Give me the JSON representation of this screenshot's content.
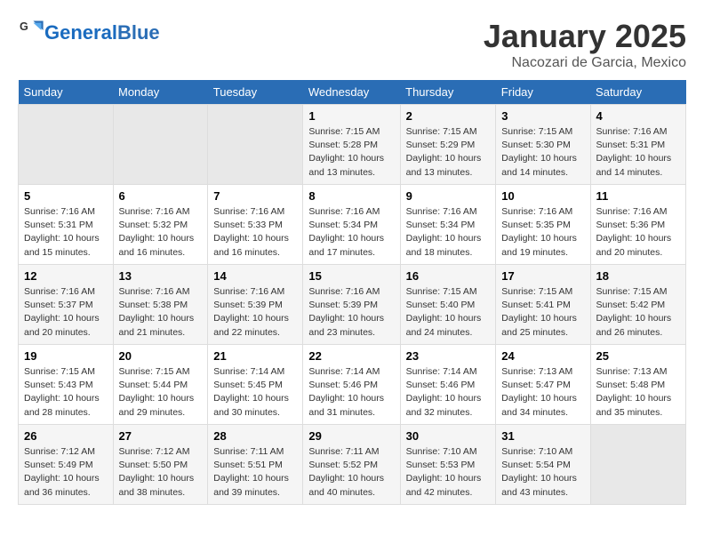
{
  "header": {
    "logo_general": "General",
    "logo_blue": "Blue",
    "month": "January 2025",
    "location": "Nacozari de Garcia, Mexico"
  },
  "days_of_week": [
    "Sunday",
    "Monday",
    "Tuesday",
    "Wednesday",
    "Thursday",
    "Friday",
    "Saturday"
  ],
  "weeks": [
    [
      {
        "empty": true
      },
      {
        "empty": true
      },
      {
        "empty": true
      },
      {
        "day": 1,
        "sunrise": "7:15 AM",
        "sunset": "5:28 PM",
        "daylight": "10 hours and 13 minutes."
      },
      {
        "day": 2,
        "sunrise": "7:15 AM",
        "sunset": "5:29 PM",
        "daylight": "10 hours and 13 minutes."
      },
      {
        "day": 3,
        "sunrise": "7:15 AM",
        "sunset": "5:30 PM",
        "daylight": "10 hours and 14 minutes."
      },
      {
        "day": 4,
        "sunrise": "7:16 AM",
        "sunset": "5:31 PM",
        "daylight": "10 hours and 14 minutes."
      }
    ],
    [
      {
        "day": 5,
        "sunrise": "7:16 AM",
        "sunset": "5:31 PM",
        "daylight": "10 hours and 15 minutes."
      },
      {
        "day": 6,
        "sunrise": "7:16 AM",
        "sunset": "5:32 PM",
        "daylight": "10 hours and 16 minutes."
      },
      {
        "day": 7,
        "sunrise": "7:16 AM",
        "sunset": "5:33 PM",
        "daylight": "10 hours and 16 minutes."
      },
      {
        "day": 8,
        "sunrise": "7:16 AM",
        "sunset": "5:34 PM",
        "daylight": "10 hours and 17 minutes."
      },
      {
        "day": 9,
        "sunrise": "7:16 AM",
        "sunset": "5:34 PM",
        "daylight": "10 hours and 18 minutes."
      },
      {
        "day": 10,
        "sunrise": "7:16 AM",
        "sunset": "5:35 PM",
        "daylight": "10 hours and 19 minutes."
      },
      {
        "day": 11,
        "sunrise": "7:16 AM",
        "sunset": "5:36 PM",
        "daylight": "10 hours and 20 minutes."
      }
    ],
    [
      {
        "day": 12,
        "sunrise": "7:16 AM",
        "sunset": "5:37 PM",
        "daylight": "10 hours and 20 minutes."
      },
      {
        "day": 13,
        "sunrise": "7:16 AM",
        "sunset": "5:38 PM",
        "daylight": "10 hours and 21 minutes."
      },
      {
        "day": 14,
        "sunrise": "7:16 AM",
        "sunset": "5:39 PM",
        "daylight": "10 hours and 22 minutes."
      },
      {
        "day": 15,
        "sunrise": "7:16 AM",
        "sunset": "5:39 PM",
        "daylight": "10 hours and 23 minutes."
      },
      {
        "day": 16,
        "sunrise": "7:15 AM",
        "sunset": "5:40 PM",
        "daylight": "10 hours and 24 minutes."
      },
      {
        "day": 17,
        "sunrise": "7:15 AM",
        "sunset": "5:41 PM",
        "daylight": "10 hours and 25 minutes."
      },
      {
        "day": 18,
        "sunrise": "7:15 AM",
        "sunset": "5:42 PM",
        "daylight": "10 hours and 26 minutes."
      }
    ],
    [
      {
        "day": 19,
        "sunrise": "7:15 AM",
        "sunset": "5:43 PM",
        "daylight": "10 hours and 28 minutes."
      },
      {
        "day": 20,
        "sunrise": "7:15 AM",
        "sunset": "5:44 PM",
        "daylight": "10 hours and 29 minutes."
      },
      {
        "day": 21,
        "sunrise": "7:14 AM",
        "sunset": "5:45 PM",
        "daylight": "10 hours and 30 minutes."
      },
      {
        "day": 22,
        "sunrise": "7:14 AM",
        "sunset": "5:46 PM",
        "daylight": "10 hours and 31 minutes."
      },
      {
        "day": 23,
        "sunrise": "7:14 AM",
        "sunset": "5:46 PM",
        "daylight": "10 hours and 32 minutes."
      },
      {
        "day": 24,
        "sunrise": "7:13 AM",
        "sunset": "5:47 PM",
        "daylight": "10 hours and 34 minutes."
      },
      {
        "day": 25,
        "sunrise": "7:13 AM",
        "sunset": "5:48 PM",
        "daylight": "10 hours and 35 minutes."
      }
    ],
    [
      {
        "day": 26,
        "sunrise": "7:12 AM",
        "sunset": "5:49 PM",
        "daylight": "10 hours and 36 minutes."
      },
      {
        "day": 27,
        "sunrise": "7:12 AM",
        "sunset": "5:50 PM",
        "daylight": "10 hours and 38 minutes."
      },
      {
        "day": 28,
        "sunrise": "7:11 AM",
        "sunset": "5:51 PM",
        "daylight": "10 hours and 39 minutes."
      },
      {
        "day": 29,
        "sunrise": "7:11 AM",
        "sunset": "5:52 PM",
        "daylight": "10 hours and 40 minutes."
      },
      {
        "day": 30,
        "sunrise": "7:10 AM",
        "sunset": "5:53 PM",
        "daylight": "10 hours and 42 minutes."
      },
      {
        "day": 31,
        "sunrise": "7:10 AM",
        "sunset": "5:54 PM",
        "daylight": "10 hours and 43 minutes."
      },
      {
        "empty": true
      }
    ]
  ]
}
